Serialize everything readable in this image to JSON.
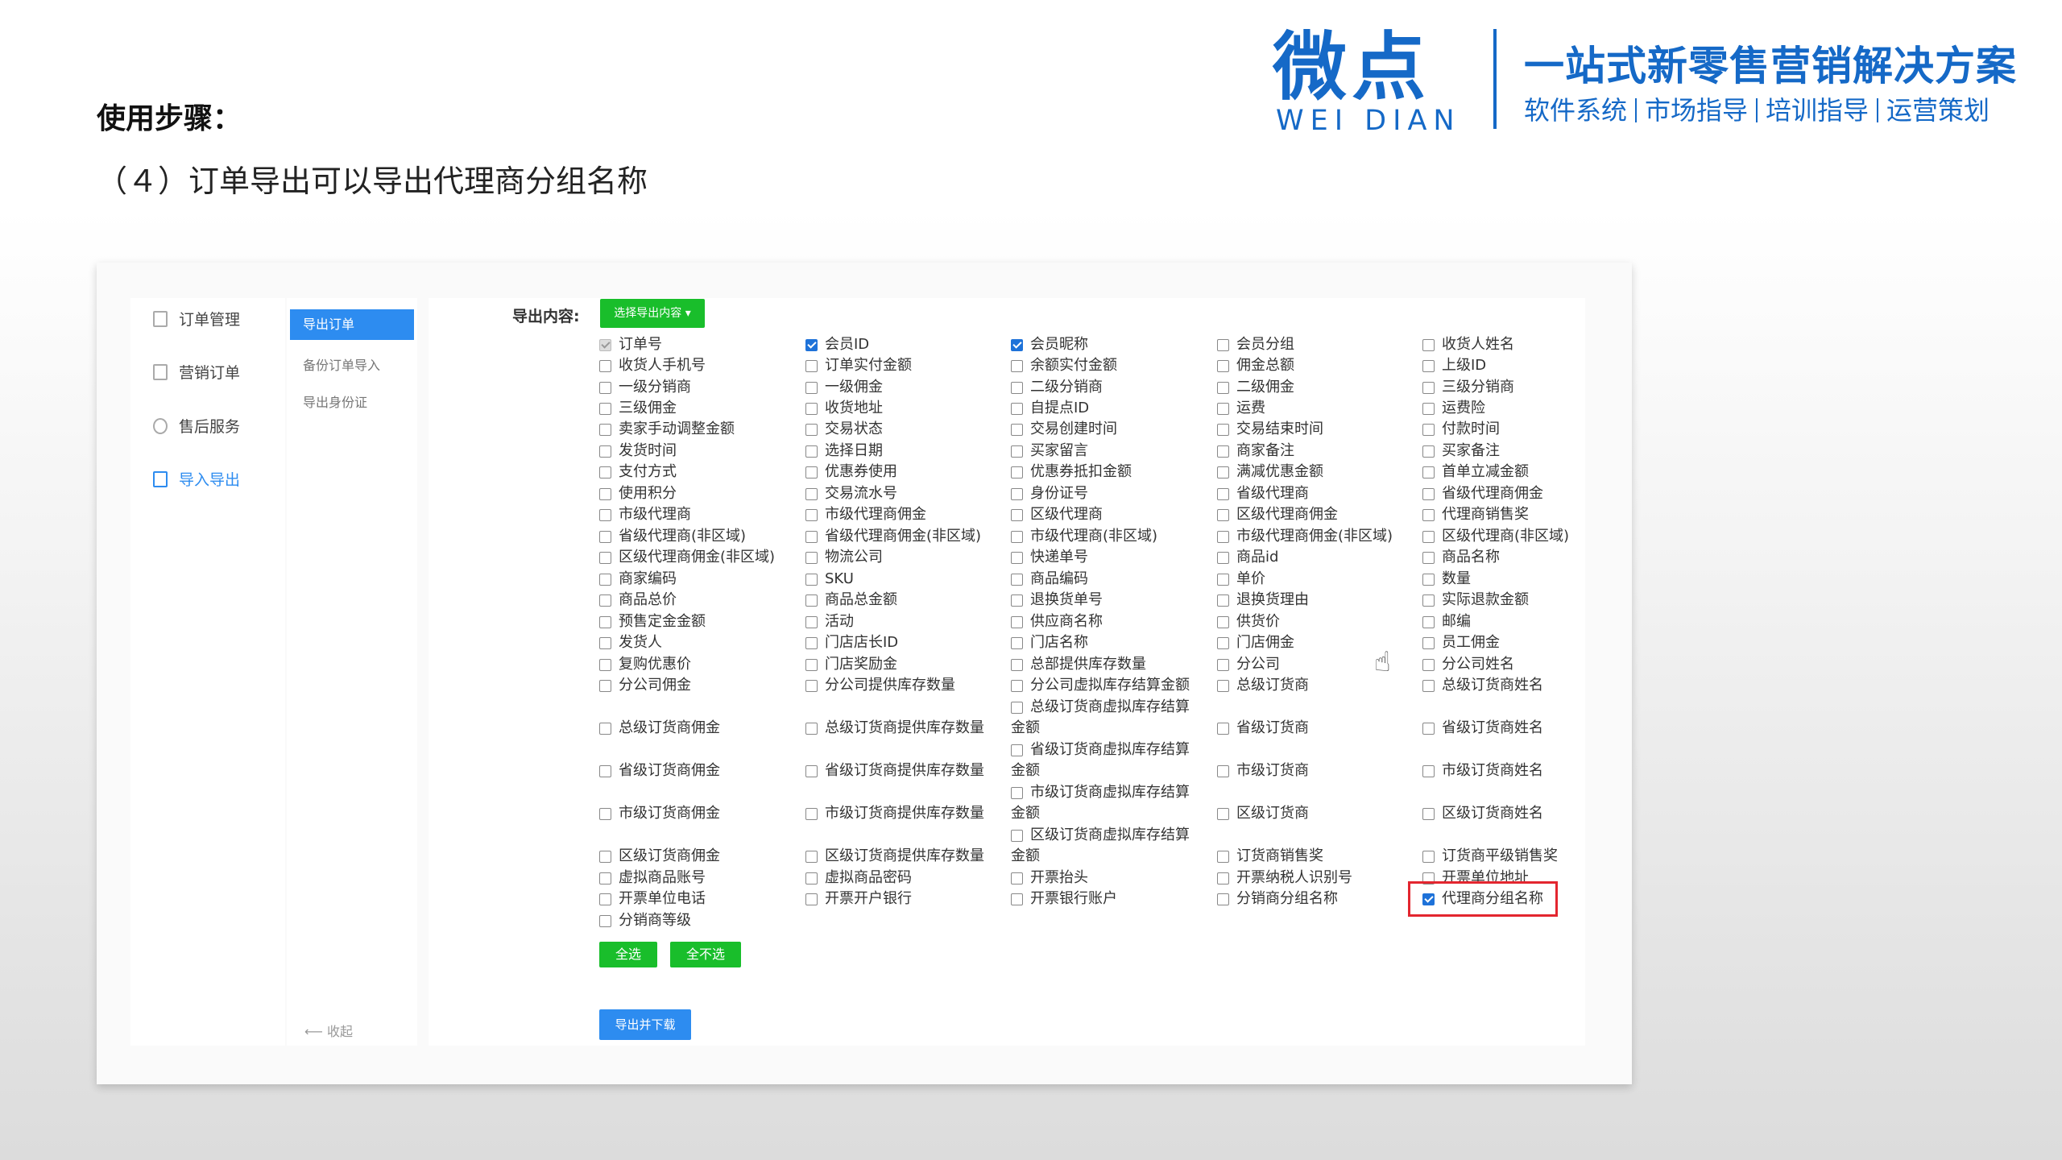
{
  "brand": {
    "logo_cn": "微点",
    "logo_en": "WEI DIAN",
    "slogan": "一站式新零售营销解决方案",
    "services": [
      "软件系统",
      "市场指导",
      "培训指导",
      "运营策划"
    ],
    "color": "#1569c7"
  },
  "header": {
    "steps_title": "使用步骤：",
    "step4": "（４）订单导出可以导出代理商分组名称"
  },
  "sidebar": {
    "items": [
      {
        "label": "订单管理",
        "icon": "document-icon",
        "active": false
      },
      {
        "label": "营销订单",
        "icon": "document-icon",
        "active": false
      },
      {
        "label": "售后服务",
        "icon": "headset-icon",
        "active": false
      },
      {
        "label": "导入导出",
        "icon": "import-export-icon",
        "active": true
      }
    ]
  },
  "subnav": {
    "items": [
      {
        "label": "导出订单",
        "active": true
      },
      {
        "label": "备份订单导入",
        "active": false
      },
      {
        "label": "导出身份证",
        "active": false
      }
    ],
    "collapse_label": "收起"
  },
  "export": {
    "label": "导出内容:",
    "select_button": "选择导出内容 ▾",
    "fields": [
      {
        "label": "订单号",
        "state": "disabled"
      },
      {
        "label": "会员ID",
        "state": "checked"
      },
      {
        "label": "会员昵称",
        "state": "checked"
      },
      {
        "label": "会员分组",
        "state": "unchecked"
      },
      {
        "label": "收货人姓名",
        "state": "unchecked"
      },
      {
        "label": "收货人手机号",
        "state": "unchecked"
      },
      {
        "label": "订单实付金额",
        "state": "unchecked"
      },
      {
        "label": "余额实付金额",
        "state": "unchecked"
      },
      {
        "label": "佣金总额",
        "state": "unchecked"
      },
      {
        "label": "上级ID",
        "state": "unchecked"
      },
      {
        "label": "一级分销商",
        "state": "unchecked"
      },
      {
        "label": "一级佣金",
        "state": "unchecked"
      },
      {
        "label": "二级分销商",
        "state": "unchecked"
      },
      {
        "label": "二级佣金",
        "state": "unchecked"
      },
      {
        "label": "三级分销商",
        "state": "unchecked"
      },
      {
        "label": "三级佣金",
        "state": "unchecked"
      },
      {
        "label": "收货地址",
        "state": "unchecked"
      },
      {
        "label": "自提点ID",
        "state": "unchecked"
      },
      {
        "label": "运费",
        "state": "unchecked"
      },
      {
        "label": "运费险",
        "state": "unchecked"
      },
      {
        "label": "卖家手动调整金额",
        "state": "unchecked"
      },
      {
        "label": "交易状态",
        "state": "unchecked"
      },
      {
        "label": "交易创建时间",
        "state": "unchecked"
      },
      {
        "label": "交易结束时间",
        "state": "unchecked"
      },
      {
        "label": "付款时间",
        "state": "unchecked"
      },
      {
        "label": "发货时间",
        "state": "unchecked"
      },
      {
        "label": "选择日期",
        "state": "unchecked"
      },
      {
        "label": "买家留言",
        "state": "unchecked"
      },
      {
        "label": "商家备注",
        "state": "unchecked"
      },
      {
        "label": "买家备注",
        "state": "unchecked"
      },
      {
        "label": "支付方式",
        "state": "unchecked"
      },
      {
        "label": "优惠券使用",
        "state": "unchecked"
      },
      {
        "label": "优惠券抵扣金额",
        "state": "unchecked"
      },
      {
        "label": "满减优惠金额",
        "state": "unchecked"
      },
      {
        "label": "首单立减金额",
        "state": "unchecked"
      },
      {
        "label": "使用积分",
        "state": "unchecked"
      },
      {
        "label": "交易流水号",
        "state": "unchecked"
      },
      {
        "label": "身份证号",
        "state": "unchecked"
      },
      {
        "label": "省级代理商",
        "state": "unchecked"
      },
      {
        "label": "省级代理商佣金",
        "state": "unchecked"
      },
      {
        "label": "市级代理商",
        "state": "unchecked"
      },
      {
        "label": "市级代理商佣金",
        "state": "unchecked"
      },
      {
        "label": "区级代理商",
        "state": "unchecked"
      },
      {
        "label": "区级代理商佣金",
        "state": "unchecked"
      },
      {
        "label": "代理商销售奖",
        "state": "unchecked"
      },
      {
        "label": "省级代理商(非区域)",
        "state": "unchecked"
      },
      {
        "label": "省级代理商佣金(非区域)",
        "state": "unchecked"
      },
      {
        "label": "市级代理商(非区域)",
        "state": "unchecked"
      },
      {
        "label": "市级代理商佣金(非区域)",
        "state": "unchecked"
      },
      {
        "label": "区级代理商(非区域)",
        "state": "unchecked"
      },
      {
        "label": "区级代理商佣金(非区域)",
        "state": "unchecked"
      },
      {
        "label": "物流公司",
        "state": "unchecked"
      },
      {
        "label": "快递单号",
        "state": "unchecked"
      },
      {
        "label": "商品id",
        "state": "unchecked"
      },
      {
        "label": "商品名称",
        "state": "unchecked"
      },
      {
        "label": "商家编码",
        "state": "unchecked"
      },
      {
        "label": "SKU",
        "state": "unchecked"
      },
      {
        "label": "商品编码",
        "state": "unchecked"
      },
      {
        "label": "单价",
        "state": "unchecked"
      },
      {
        "label": "数量",
        "state": "unchecked"
      },
      {
        "label": "商品总价",
        "state": "unchecked"
      },
      {
        "label": "商品总金额",
        "state": "unchecked"
      },
      {
        "label": "退换货单号",
        "state": "unchecked"
      },
      {
        "label": "退换货理由",
        "state": "unchecked"
      },
      {
        "label": "实际退款金额",
        "state": "unchecked"
      },
      {
        "label": "预售定金金额",
        "state": "unchecked"
      },
      {
        "label": "活动",
        "state": "unchecked"
      },
      {
        "label": "供应商名称",
        "state": "unchecked"
      },
      {
        "label": "供货价",
        "state": "unchecked"
      },
      {
        "label": "邮编",
        "state": "unchecked"
      },
      {
        "label": "发货人",
        "state": "unchecked"
      },
      {
        "label": "门店店长ID",
        "state": "unchecked"
      },
      {
        "label": "门店名称",
        "state": "unchecked"
      },
      {
        "label": "门店佣金",
        "state": "unchecked"
      },
      {
        "label": "员工佣金",
        "state": "unchecked"
      },
      {
        "label": "复购优惠价",
        "state": "unchecked"
      },
      {
        "label": "门店奖励金",
        "state": "unchecked"
      },
      {
        "label": "总部提供库存数量",
        "state": "unchecked"
      },
      {
        "label": "分公司",
        "state": "unchecked"
      },
      {
        "label": "分公司姓名",
        "state": "unchecked"
      },
      {
        "label": "分公司佣金",
        "state": "unchecked"
      },
      {
        "label": "分公司提供库存数量",
        "state": "unchecked"
      },
      {
        "label": "分公司虚拟库存结算金额",
        "state": "unchecked"
      },
      {
        "label": "总级订货商",
        "state": "unchecked"
      },
      {
        "label": "总级订货商姓名",
        "state": "unchecked"
      },
      {
        "label": "总级订货商佣金",
        "state": "unchecked"
      },
      {
        "label": "总级订货商提供库存数量",
        "state": "unchecked"
      },
      {
        "label": "总级订货商虚拟库存结算",
        "wrap": "金额",
        "state": "unchecked"
      },
      {
        "label": "省级订货商",
        "state": "unchecked"
      },
      {
        "label": "省级订货商姓名",
        "state": "unchecked"
      },
      {
        "label": "省级订货商佣金",
        "state": "unchecked"
      },
      {
        "label": "省级订货商提供库存数量",
        "state": "unchecked"
      },
      {
        "label": "省级订货商虚拟库存结算",
        "wrap": "金额",
        "state": "unchecked"
      },
      {
        "label": "市级订货商",
        "state": "unchecked"
      },
      {
        "label": "市级订货商姓名",
        "state": "unchecked"
      },
      {
        "label": "市级订货商佣金",
        "state": "unchecked"
      },
      {
        "label": "市级订货商提供库存数量",
        "state": "unchecked"
      },
      {
        "label": "市级订货商虚拟库存结算",
        "wrap": "金额",
        "state": "unchecked"
      },
      {
        "label": "区级订货商",
        "state": "unchecked"
      },
      {
        "label": "区级订货商姓名",
        "state": "unchecked"
      },
      {
        "label": "区级订货商佣金",
        "state": "unchecked"
      },
      {
        "label": "区级订货商提供库存数量",
        "state": "unchecked"
      },
      {
        "label": "区级订货商虚拟库存结算",
        "wrap": "金额",
        "state": "unchecked"
      },
      {
        "label": "订货商销售奖",
        "state": "unchecked"
      },
      {
        "label": "订货商平级销售奖",
        "state": "unchecked"
      },
      {
        "label": "虚拟商品账号",
        "state": "unchecked"
      },
      {
        "label": "虚拟商品密码",
        "state": "unchecked"
      },
      {
        "label": "开票抬头",
        "state": "unchecked"
      },
      {
        "label": "开票纳税人识别号",
        "state": "unchecked"
      },
      {
        "label": "开票单位地址",
        "state": "unchecked"
      },
      {
        "label": "开票单位电话",
        "state": "unchecked"
      },
      {
        "label": "开票开户银行",
        "state": "unchecked"
      },
      {
        "label": "开票银行账户",
        "state": "unchecked"
      },
      {
        "label": "分销商分组名称",
        "state": "unchecked"
      },
      {
        "label": "代理商分组名称",
        "state": "checked",
        "highlight": true
      },
      {
        "label": "分销商等级",
        "state": "unchecked"
      }
    ],
    "select_all": "全选",
    "select_none": "全不选",
    "export_download": "导出并下载"
  }
}
